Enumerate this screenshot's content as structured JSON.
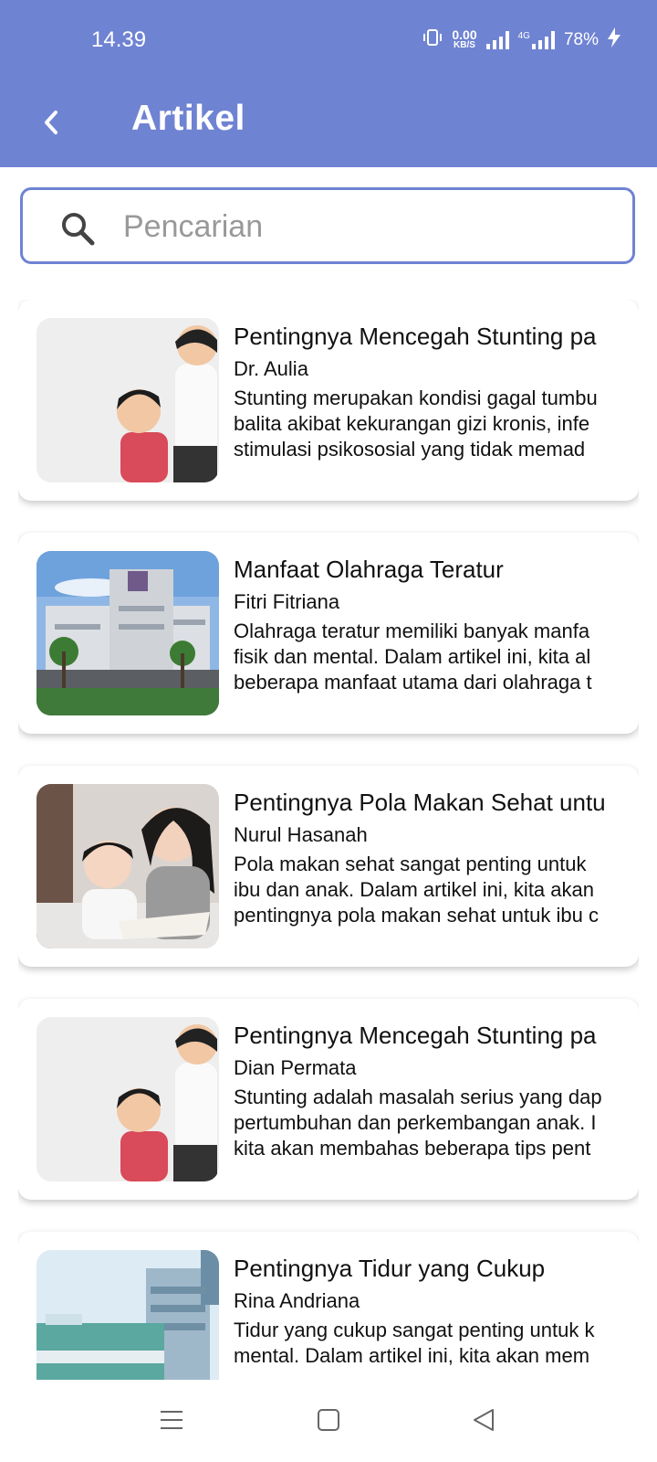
{
  "status_bar": {
    "time": "14.39",
    "net_speed_value": "0.00",
    "net_speed_unit": "KB/S",
    "network_type": "4G",
    "battery": "78%"
  },
  "app_bar": {
    "title": "Artikel",
    "back_icon": "chevron-left-icon"
  },
  "search": {
    "placeholder": "Pencarian",
    "value": "",
    "icon": "search-icon"
  },
  "articles": [
    {
      "title": "Pentingnya Mencegah Stunting pa",
      "author": "Dr. Aulia",
      "excerpt_lines": [
        "Stunting merupakan kondisi gagal tumbu",
        "balita akibat kekurangan gizi kronis, infe",
        "stimulasi psikososial yang tidak memad"
      ],
      "image": "children-photo"
    },
    {
      "title": "Manfaat Olahraga Teratur",
      "author": "Fitri Fitriana",
      "excerpt_lines": [
        "Olahraga teratur memiliki banyak manfa",
        "fisik dan mental. Dalam artikel ini, kita al",
        "beberapa manfaat utama dari olahraga t"
      ],
      "image": "hospital-building-photo"
    },
    {
      "title": "Pentingnya Pola Makan Sehat untu",
      "author": "Nurul Hasanah",
      "excerpt_lines": [
        "Pola makan sehat sangat penting untuk",
        "ibu dan anak. Dalam artikel ini, kita akan",
        "pentingnya pola makan sehat untuk ibu c"
      ],
      "image": "mother-child-reading-photo"
    },
    {
      "title": "Pentingnya Mencegah Stunting pa",
      "author": "Dian Permata",
      "excerpt_lines": [
        "Stunting adalah masalah serius yang dap",
        "pertumbuhan dan perkembangan anak. I",
        "kita akan membahas beberapa tips pent"
      ],
      "image": "children-photo"
    },
    {
      "title": "Pentingnya Tidur yang Cukup",
      "author": "Rina Andriana",
      "excerpt_lines": [
        "Tidur yang cukup sangat penting untuk k",
        "mental. Dalam artikel ini, kita akan mem",
        ""
      ],
      "image": "hospital-tower-photo"
    }
  ],
  "nav_bar": {
    "buttons": [
      "menu-icon",
      "home-square-icon",
      "back-triangle-icon"
    ]
  },
  "colors": {
    "primary": "#6f83d3",
    "background": "#ffffff"
  }
}
